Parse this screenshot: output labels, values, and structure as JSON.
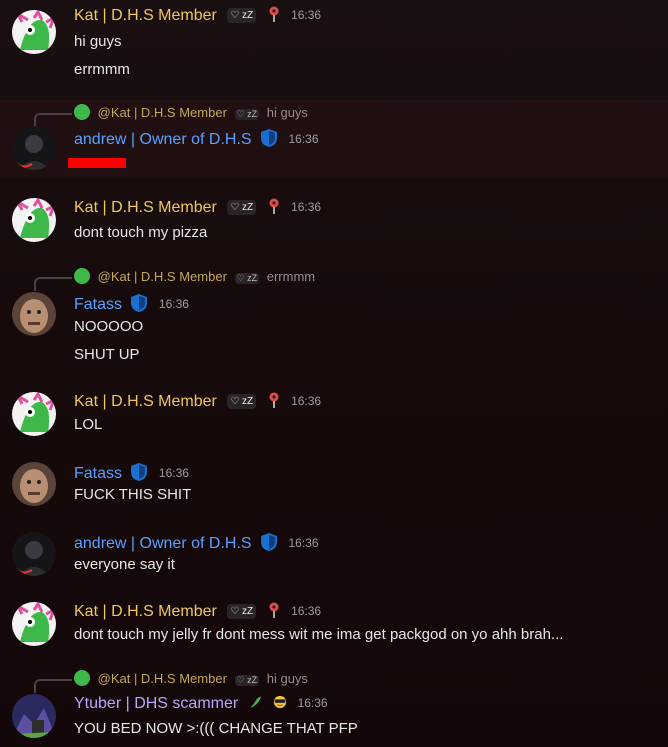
{
  "messages": [
    {
      "name": "Kat | D.H.S Member",
      "time": "16:36",
      "lines": [
        "hi guys",
        "errmmm"
      ]
    },
    {
      "reply": {
        "name": "@Kat | D.H.S Member",
        "text": "hi guys"
      },
      "name": "andrew | Owner of D.H.S",
      "time": "16:36",
      "lines": []
    },
    {
      "name": "Kat | D.H.S Member",
      "time": "16:36",
      "lines": [
        "dont touch my pizza"
      ]
    },
    {
      "reply": {
        "name": "@Kat | D.H.S Member",
        "text": "errmmm"
      },
      "name": "Fatass",
      "time": "16:36",
      "lines": [
        "NOOOOO",
        "SHUT UP"
      ]
    },
    {
      "name": "Kat | D.H.S Member",
      "time": "16:36",
      "lines": [
        "LOL"
      ]
    },
    {
      "name": "Fatass",
      "time": "16:36",
      "lines": [
        "FUCK THIS SHIT"
      ]
    },
    {
      "name": "andrew | Owner of D.H.S",
      "time": "16:36",
      "lines": [
        "everyone say it"
      ]
    },
    {
      "name": "Kat | D.H.S Member",
      "time": "16:36",
      "lines": [
        "dont touch my jelly fr dont mess wit me ima get packgod on yo ahh brah..."
      ]
    },
    {
      "reply": {
        "name": "@Kat | D.H.S Member",
        "text": "hi guys"
      },
      "name": "Ytuber | DHS scammer",
      "time": "16:36",
      "lines": [
        "YOU BED NOW >:((( CHANGE THAT PFP"
      ]
    }
  ],
  "tag_text": "♡ zZ",
  "colors": {
    "kat": "#f0c75e",
    "andrew": "#5aa0ff",
    "ytuber": "#b9a7ff",
    "redaction": "#ff0000"
  }
}
